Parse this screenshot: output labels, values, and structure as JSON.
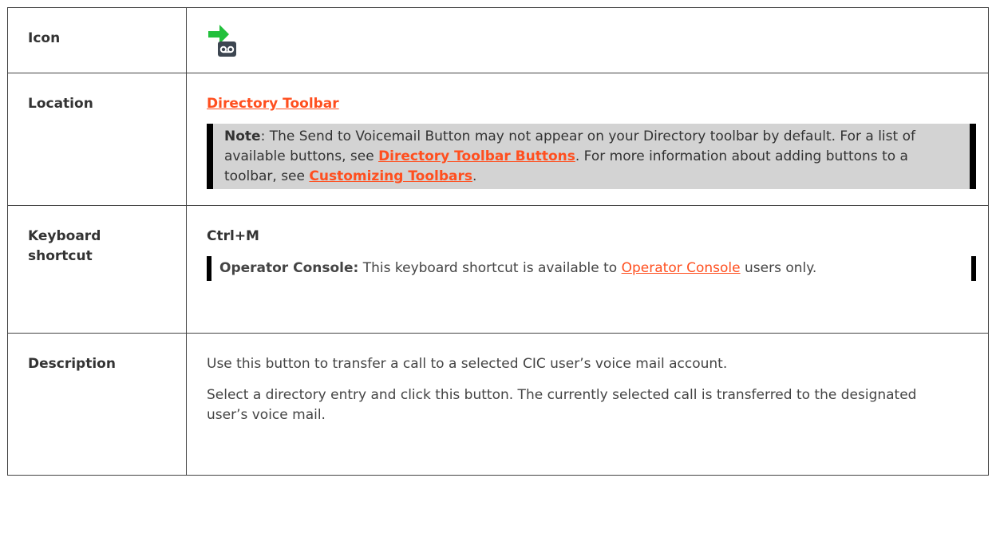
{
  "rows": {
    "icon": {
      "label": "Icon",
      "icon_name": "send-to-voicemail-icon"
    },
    "location": {
      "label": "Location",
      "link": "Directory Toolbar",
      "note": {
        "lead": "Note",
        "text1": ": The Send to Voicemail Button may not appear on your Directory toolbar by default. For a list of available buttons, see ",
        "link1": "Directory Toolbar Buttons",
        "text2": ". For more information about adding buttons to a toolbar, see ",
        "link2": "Customizing Toolbars",
        "text3": "."
      }
    },
    "shortcut": {
      "label": "Keyboard shortcut",
      "keys": "Ctrl+M",
      "note": {
        "lead": "Operator Console:",
        "text1": " This keyboard shortcut is available to ",
        "link": "Operator Console",
        "text2": " users only."
      }
    },
    "description": {
      "label": "Description",
      "para1": "Use this button to transfer a call to a selected CIC user’s voice mail account.",
      "para2": "Select a directory entry and click this button. The currently selected call is transferred to the designated user’s voice mail."
    }
  },
  "colors": {
    "link": "#ff4f1f",
    "note_bg": "#d3d3d3",
    "arrow": "#22c03c",
    "tape_bg": "#3d4651"
  }
}
